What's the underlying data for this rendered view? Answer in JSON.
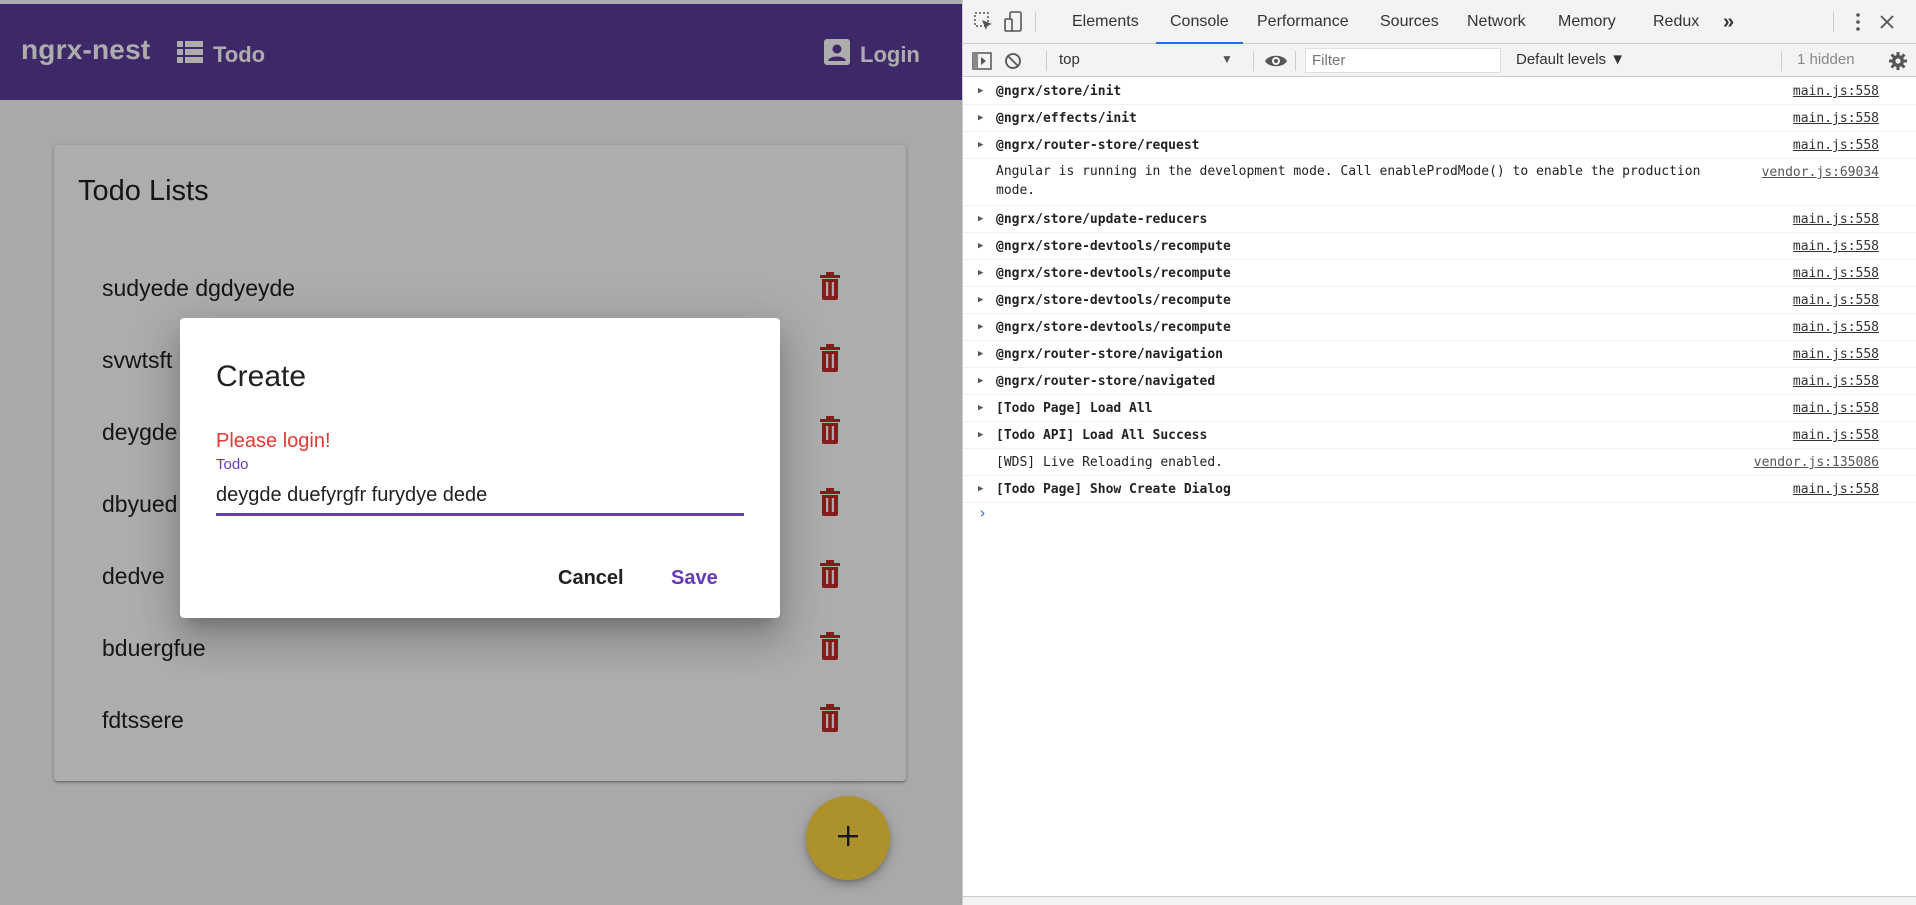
{
  "app": {
    "brand": "ngrx-nest",
    "nav_todo_label": "Todo",
    "nav_login_label": "Login",
    "card_title": "Todo Lists",
    "todos": [
      "sudyede dgdyeyde",
      "svwtsft",
      "deygde",
      "dbyued",
      "dedve",
      "bduergfue",
      "fdtssere"
    ],
    "fab_label": "+",
    "colors": {
      "toolbar": "#5c3c99",
      "accent": "#673ab7",
      "warn": "#c62828",
      "fab": "#ffd740",
      "error": "#e53935"
    }
  },
  "dialog": {
    "title": "Create",
    "error": "Please login!",
    "field_label": "Todo",
    "field_value": "deygde duefyrgfr furydye dede",
    "cancel_label": "Cancel",
    "save_label": "Save"
  },
  "devtools": {
    "tabs": [
      "Elements",
      "Console",
      "Performance",
      "Sources",
      "Network",
      "Memory",
      "Redux"
    ],
    "active_tab": "Console",
    "more_tabs": "»",
    "context": "top",
    "filter_placeholder": "Filter",
    "levels": "Default levels ▼",
    "hidden_count": "1 hidden",
    "logs": [
      {
        "text": "@ngrx/store/init",
        "source": "main.js:558",
        "expandable": true
      },
      {
        "text": "@ngrx/effects/init",
        "source": "main.js:558",
        "expandable": true
      },
      {
        "text": "@ngrx/router-store/request",
        "source": "main.js:558",
        "expandable": true
      },
      {
        "text": "Angular is running in the development mode. Call enableProdMode() to enable the production mode.",
        "source": "vendor.js:69034",
        "expandable": false
      },
      {
        "text": "@ngrx/store/update-reducers",
        "source": "main.js:558",
        "expandable": true
      },
      {
        "text": "@ngrx/store-devtools/recompute",
        "source": "main.js:558",
        "expandable": true
      },
      {
        "text": "@ngrx/store-devtools/recompute",
        "source": "main.js:558",
        "expandable": true
      },
      {
        "text": "@ngrx/store-devtools/recompute",
        "source": "main.js:558",
        "expandable": true
      },
      {
        "text": "@ngrx/store-devtools/recompute",
        "source": "main.js:558",
        "expandable": true
      },
      {
        "text": "@ngrx/router-store/navigation",
        "source": "main.js:558",
        "expandable": true
      },
      {
        "text": "@ngrx/router-store/navigated",
        "source": "main.js:558",
        "expandable": true
      },
      {
        "text": "[Todo Page] Load All",
        "source": "main.js:558",
        "expandable": true
      },
      {
        "text": "[Todo API] Load All Success",
        "source": "main.js:558",
        "expandable": true
      },
      {
        "text": "[WDS] Live Reloading enabled.",
        "source": "vendor.js:135086",
        "expandable": false
      },
      {
        "text": "[Todo Page] Show Create Dialog",
        "source": "main.js:558",
        "expandable": true
      }
    ],
    "prompt_symbol": "›"
  }
}
